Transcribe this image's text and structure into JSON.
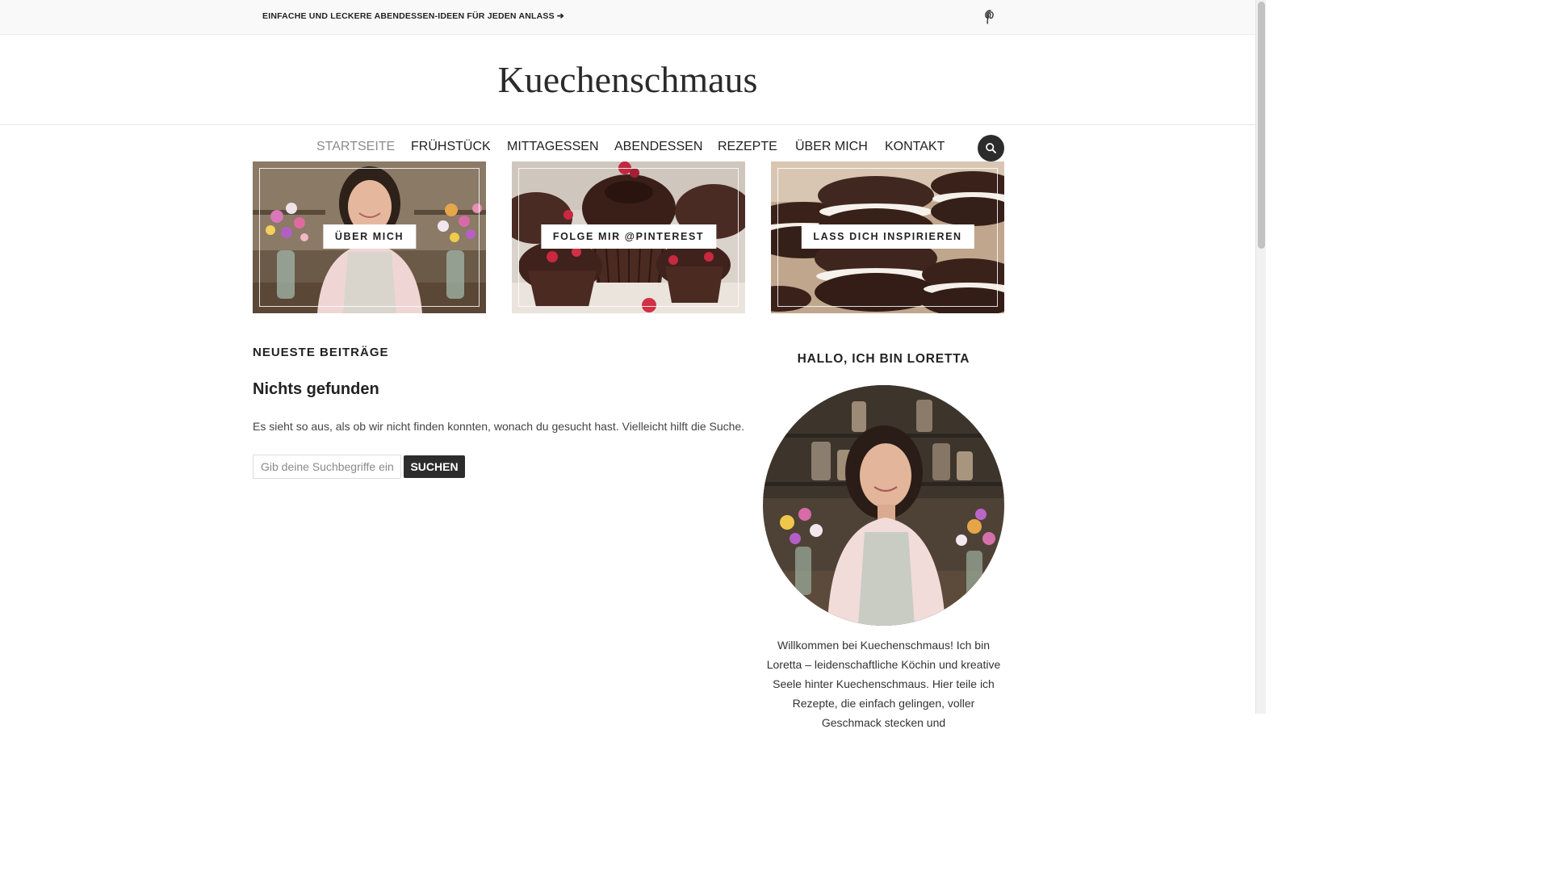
{
  "topbar": {
    "promo_link": "EINFACHE UND LECKERE ABENDESSEN-IDEEN FÜR JEDEN ANLASS ➔",
    "social_icon": "pinterest-icon"
  },
  "header": {
    "site_title": "Kuechenschmaus"
  },
  "nav": {
    "items": [
      "STARTSEITE",
      "FRÜHSTÜCK",
      "MITTAGESSEN",
      "ABENDESSEN",
      "REZEPTE",
      "ÜBER MICH",
      "KONTAKT"
    ],
    "active_index": 0,
    "search_icon": "search-icon"
  },
  "tiles": [
    {
      "label": "ÜBER MICH"
    },
    {
      "label": "FOLGE MIR @PINTEREST"
    },
    {
      "label": "LASS DICH INSPIRIEREN"
    }
  ],
  "main": {
    "section_heading": "NEUESTE BEITRÄGE",
    "nothing_title": "Nichts gefunden",
    "nothing_text": "Es sieht so aus, als ob wir nicht finden konnten, wonach du gesucht hast. Vielleicht hilft die Suche.",
    "search_placeholder": "Gib deine Suchbegriffe ein..",
    "search_button": "SUCHEN"
  },
  "sidebar": {
    "title": "HALLO, ICH BIN LORETTA",
    "text": "Willkommen bei Kuechenschmaus! Ich bin Loretta – leidenschaftliche Köchin und kreative Seele hinter Kuechenschmaus. Hier teile ich Rezepte, die einfach gelingen, voller Geschmack stecken und"
  },
  "colors": {
    "dark_button": "#2c2c2c",
    "nav_active": "#8c8c8c",
    "topbar_bg": "#f9f9f9"
  }
}
